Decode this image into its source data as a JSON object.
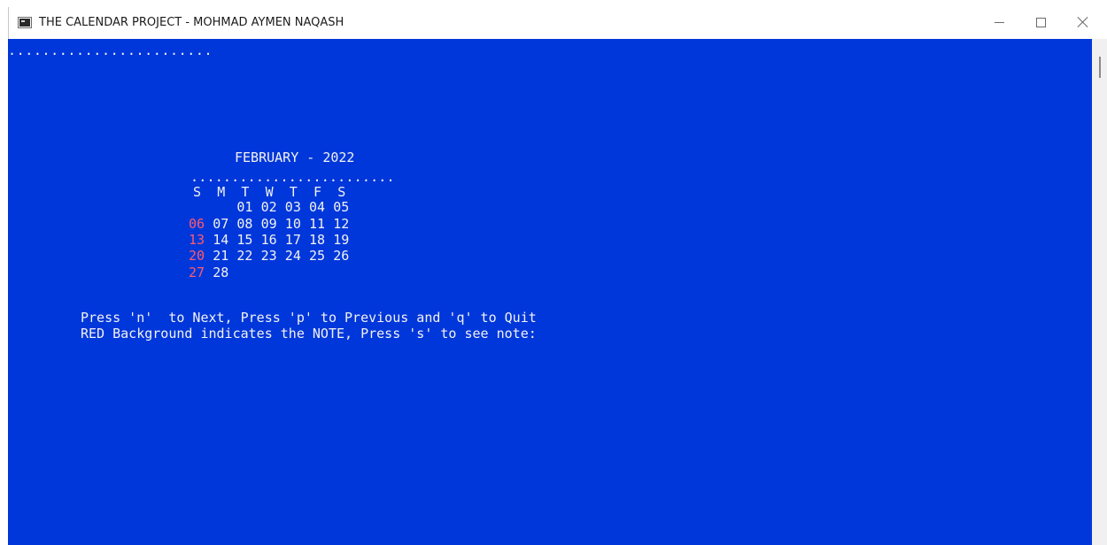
{
  "window": {
    "title": "THE CALENDAR PROJECT - MOHMAD AYMEN NAQASH",
    "icon": "console-app-icon",
    "controls": [
      "minimize",
      "maximize",
      "close"
    ]
  },
  "console": {
    "background_color": "#0037da",
    "text_color": "#f2f2f2",
    "sunday_color": "#ff5a6e",
    "top_dots": "........................",
    "calendar": {
      "title": "FEBRUARY - 2022",
      "separator": ".........................",
      "weekdays": [
        "S",
        "M",
        "T",
        "W",
        "T",
        "F",
        "S"
      ],
      "weeks": [
        [
          "",
          "",
          "01",
          "02",
          "03",
          "04",
          "05"
        ],
        [
          "06",
          "07",
          "08",
          "09",
          "10",
          "11",
          "12"
        ],
        [
          "13",
          "14",
          "15",
          "16",
          "17",
          "18",
          "19"
        ],
        [
          "20",
          "21",
          "22",
          "23",
          "24",
          "25",
          "26"
        ],
        [
          "27",
          "28",
          "",
          "",
          "",
          "",
          ""
        ]
      ]
    },
    "instructions": [
      "Press 'n'  to Next, Press 'p' to Previous and 'q' to Quit",
      "RED Background indicates the NOTE, Press 's' to see note:"
    ]
  }
}
